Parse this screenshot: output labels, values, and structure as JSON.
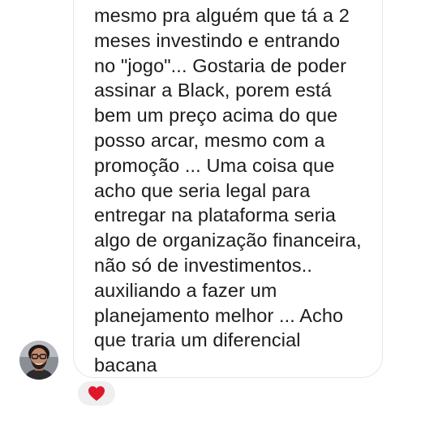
{
  "message": {
    "text": "mesmo pra alguém que tá a 2\nmeses investindo e entrando\nno \"jogo\"... Gostaria de poder\nassinar a Black, porem está\nbem um preço acima do que\nposso arcar, mesmo com a\npromoção ... Uma coisa que\nacho que seria legal para\nentregar na plataforma seria\nalgo de organização financeira,\nnão só de investimentos..\nauxiliando a fazer um\nplanejamento melhor ... Acho\nque traria um diferencial\nbacana"
  },
  "reaction": {
    "icon": "heart-icon",
    "color": "#e0162b"
  },
  "sender": {
    "avatar_icon": "user-avatar"
  }
}
